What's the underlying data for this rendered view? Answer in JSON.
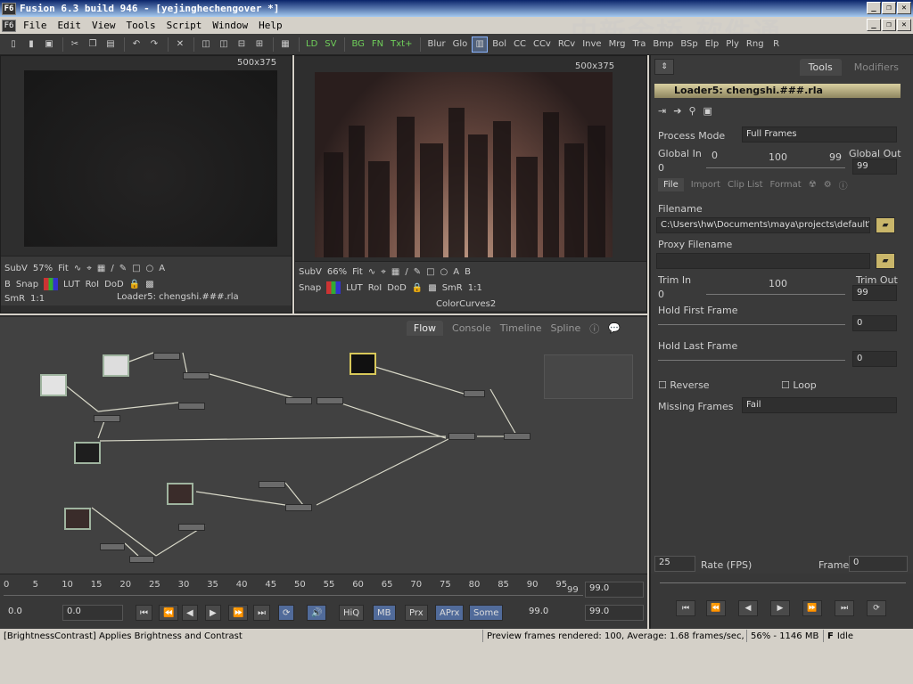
{
  "window": {
    "title": "Fusion 6.3 build 946 - [yejinghechengover *]",
    "icon": "F6"
  },
  "watermark": "中新金桥 软件通",
  "menu": [
    "File",
    "Edit",
    "View",
    "Tools",
    "Script",
    "Window",
    "Help"
  ],
  "toolbar": {
    "tools": [
      "LD",
      "SV",
      "BG",
      "FN",
      "Txt+",
      "Blur",
      "Glo",
      "BC",
      "Bol",
      "CC",
      "CCv",
      "RCv",
      "Inve",
      "Mrg",
      "Tra",
      "Bmp",
      "BSp",
      "Elp",
      "Ply",
      "Rng",
      "R"
    ]
  },
  "viewer1": {
    "res": "500x375",
    "subv": "SubV",
    "zoom": "57%",
    "fit": "Fit",
    "snap": "Snap",
    "lut": "LUT",
    "roi": "RoI",
    "dod": "DoD",
    "smr": "SmR",
    "ratio": "1:1",
    "name": "Loader5: chengshi.###.rla"
  },
  "viewer2": {
    "res": "500x375",
    "subv": "SubV",
    "zoom": "66%",
    "fit": "Fit",
    "snap": "Snap",
    "lut": "LUT",
    "roi": "RoI",
    "dod": "DoD",
    "smr": "SmR",
    "ratio": "1:1",
    "name": "ColorCurves2"
  },
  "flow": {
    "tabs": [
      "Flow",
      "Console",
      "Timeline",
      "Spline"
    ]
  },
  "panel": {
    "tabs": [
      "Tools",
      "Modifiers"
    ],
    "header": "Loader5: chengshi.###.rla",
    "process_mode_label": "Process Mode",
    "process_mode": "Full Frames",
    "global_in_label": "Global In",
    "global_in": "0",
    "global_out_label": "Global Out",
    "global_out": "99",
    "global_scale": {
      "min": "0",
      "mid": "100",
      "max": "99"
    },
    "subtabs": [
      "File",
      "Import",
      "Clip List",
      "Format"
    ],
    "filename_label": "Filename",
    "filename": "C:\\Users\\hw\\Documents\\maya\\projects\\default\\i",
    "proxy_label": "Proxy Filename",
    "trim_in_label": "Trim In",
    "trim_in": "0",
    "trim_out_label": "Trim Out",
    "trim_out": "99",
    "trim_scale": {
      "min": "0",
      "mid": "100"
    },
    "hold_first_label": "Hold First Frame",
    "hold_first": "0",
    "hold_last_label": "Hold Last Frame",
    "hold_last": "0",
    "reverse_label": "Reverse",
    "loop_label": "Loop",
    "missing_label": "Missing Frames",
    "missing": "Fail"
  },
  "timeline": {
    "ticks": [
      "0",
      "5",
      "10",
      "15",
      "20",
      "25",
      "30",
      "35",
      "40",
      "45",
      "50",
      "55",
      "60",
      "65",
      "70",
      "75",
      "80",
      "85",
      "90",
      "95"
    ],
    "end_marker": "99",
    "end_value": "99.0",
    "start": "0.0",
    "current": "0.0",
    "current2": "99.0",
    "end2": "99.0",
    "buttons": [
      "HiQ",
      "MB",
      "Prx",
      "APrx",
      "Some"
    ]
  },
  "transport": {
    "fps": "25",
    "rate_label": "Rate (FPS)",
    "frame_label": "Frame",
    "frame": "0"
  },
  "status": {
    "hint": "[BrightnessContrast] Applies Brightness and Contrast",
    "preview": "Preview frames rendered: 100,  Average: 1.68 frames/sec,",
    "mem": "56% - 1146 MB",
    "state": "Idle"
  }
}
